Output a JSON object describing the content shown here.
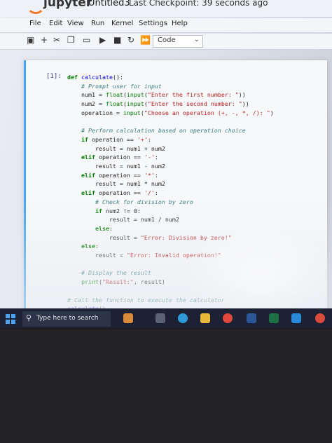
{
  "header": {
    "brand": "jupyter",
    "notebook_title": "Untitled3",
    "checkpoint": "Last Checkpoint: 39 seconds ago"
  },
  "menu": [
    "File",
    "Edit",
    "View",
    "Run",
    "Kernel",
    "Settings",
    "Help"
  ],
  "toolbar": {
    "cell_type": "Code"
  },
  "cell": {
    "prompt": "[1]:",
    "lines": [
      "def calculate():",
      "    # Prompt user for input",
      "    num1 = float(input(\"Enter the first number: \"))",
      "    num2 = float(input(\"Enter the second number: \"))",
      "    operation = input(\"Choose an operation (+, -, *, /): \")",
      "",
      "    # Perform calculation based on operation choice",
      "    if operation == '+':",
      "        result = num1 + num2",
      "    elif operation == '-':",
      "        result = num1 - num2",
      "    elif operation == '*':",
      "        result = num1 * num2",
      "    elif operation == '/':",
      "        # Check for division by zero",
      "        if num2 != 0:",
      "            result = num1 / num2",
      "        else:",
      "            result = \"Error: Division by zero!\"",
      "    else:",
      "        result = \"Error: Invalid operation!\"",
      "",
      "    # Display the result",
      "    print(\"Result:\", result)",
      "",
      "# Call the function to execute the calculator",
      "calculate()"
    ]
  },
  "taskbar": {
    "search_placeholder": "Type here to search"
  },
  "colors": {
    "orange": "#f37726",
    "keyword": "#008000",
    "string": "#ba2121",
    "comment": "#408080"
  }
}
